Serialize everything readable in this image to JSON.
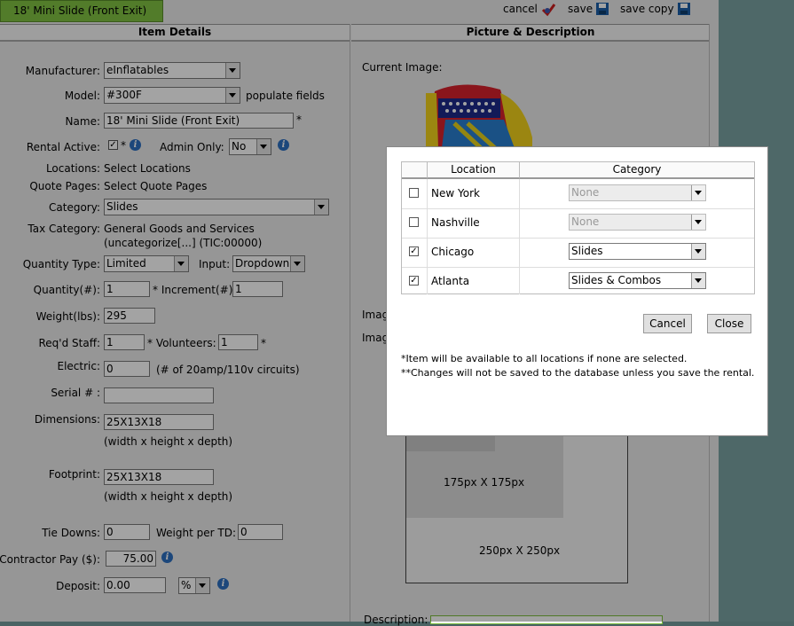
{
  "header": {
    "tab_title": "18' Mini Slide (Front Exit)",
    "cancel": "cancel",
    "save": "save",
    "save_copy": "save copy"
  },
  "columns": {
    "left": "Item Details",
    "right": "Picture & Description"
  },
  "form": {
    "manufacturer": {
      "label": "Manufacturer:",
      "value": "eInflatables"
    },
    "model": {
      "label": "Model:",
      "value": "#300F",
      "hint": "populate fields"
    },
    "name": {
      "label": "Name:",
      "value": "18' Mini Slide (Front Exit)",
      "required": "*"
    },
    "rental_active": {
      "label": "Rental Active:",
      "checked": true,
      "required": "*"
    },
    "admin_only": {
      "label": "Admin Only:",
      "value": "No"
    },
    "locations": {
      "label": "Locations:",
      "value": "Select Locations"
    },
    "quote_pages": {
      "label": "Quote Pages:",
      "value": "Select Quote Pages"
    },
    "category": {
      "label": "Category:",
      "value": "Slides"
    },
    "tax_category": {
      "label": "Tax Category:",
      "line1": "General Goods and Services",
      "line2": "(uncategorize[...] (TIC:00000)"
    },
    "quantity_type": {
      "label": "Quantity Type:",
      "value": "Limited"
    },
    "input": {
      "label": "Input:",
      "value": "Dropdown"
    },
    "quantity": {
      "label": "Quantity(#):",
      "value": "1"
    },
    "increment": {
      "label": "* Increment(#):",
      "value": "1"
    },
    "weight": {
      "label": "Weight(lbs):",
      "value": "295"
    },
    "reqd_staff": {
      "label": "Req'd Staff:",
      "value": "1"
    },
    "volunteers": {
      "label": "* Volunteers:",
      "value": "1",
      "required": "*"
    },
    "electric": {
      "label": "Electric:",
      "value": "0",
      "hint": "(# of 20amp/110v circuits)"
    },
    "serial": {
      "label": "Serial # :",
      "value": ""
    },
    "dimensions": {
      "label": "Dimensions:",
      "value": "25X13X18",
      "hint": "(width x height x depth)"
    },
    "footprint": {
      "label": "Footprint:",
      "value": "25X13X18",
      "hint": "(width x height x depth)"
    },
    "tie_downs": {
      "label": "Tie Downs:",
      "value": "0"
    },
    "weight_per_td": {
      "label": "Weight per TD:",
      "value": "0"
    },
    "contractor_pay": {
      "label": "Contractor Pay ($):",
      "value": "75.00"
    },
    "deposit": {
      "label": "Deposit:",
      "value": "0.00",
      "unit": "%"
    }
  },
  "picture": {
    "current_image": "Current Image:",
    "image_label_1": "Imag",
    "image_label_2": "Imag",
    "size_small": "175px X 175px",
    "size_large": "250px X 250px",
    "description": "Description:"
  },
  "modal": {
    "headers": {
      "location": "Location",
      "category": "Category"
    },
    "rows": [
      {
        "location": "New York",
        "checked": false,
        "category": "None",
        "enabled": false
      },
      {
        "location": "Nashville",
        "checked": false,
        "category": "None",
        "enabled": false
      },
      {
        "location": "Chicago",
        "checked": true,
        "category": "Slides",
        "enabled": true
      },
      {
        "location": "Atlanta",
        "checked": true,
        "category": "Slides & Combos",
        "enabled": true
      }
    ],
    "cancel": "Cancel",
    "close": "Close",
    "note1": "*Item will be available to all locations if none are selected.",
    "note2": "**Changes will not be saved to the database unless you save the rental."
  },
  "colors": {
    "tab_green": "#80c342",
    "accent_blue": "#2c6fc1",
    "cancel_red": "#cc1f1f"
  }
}
